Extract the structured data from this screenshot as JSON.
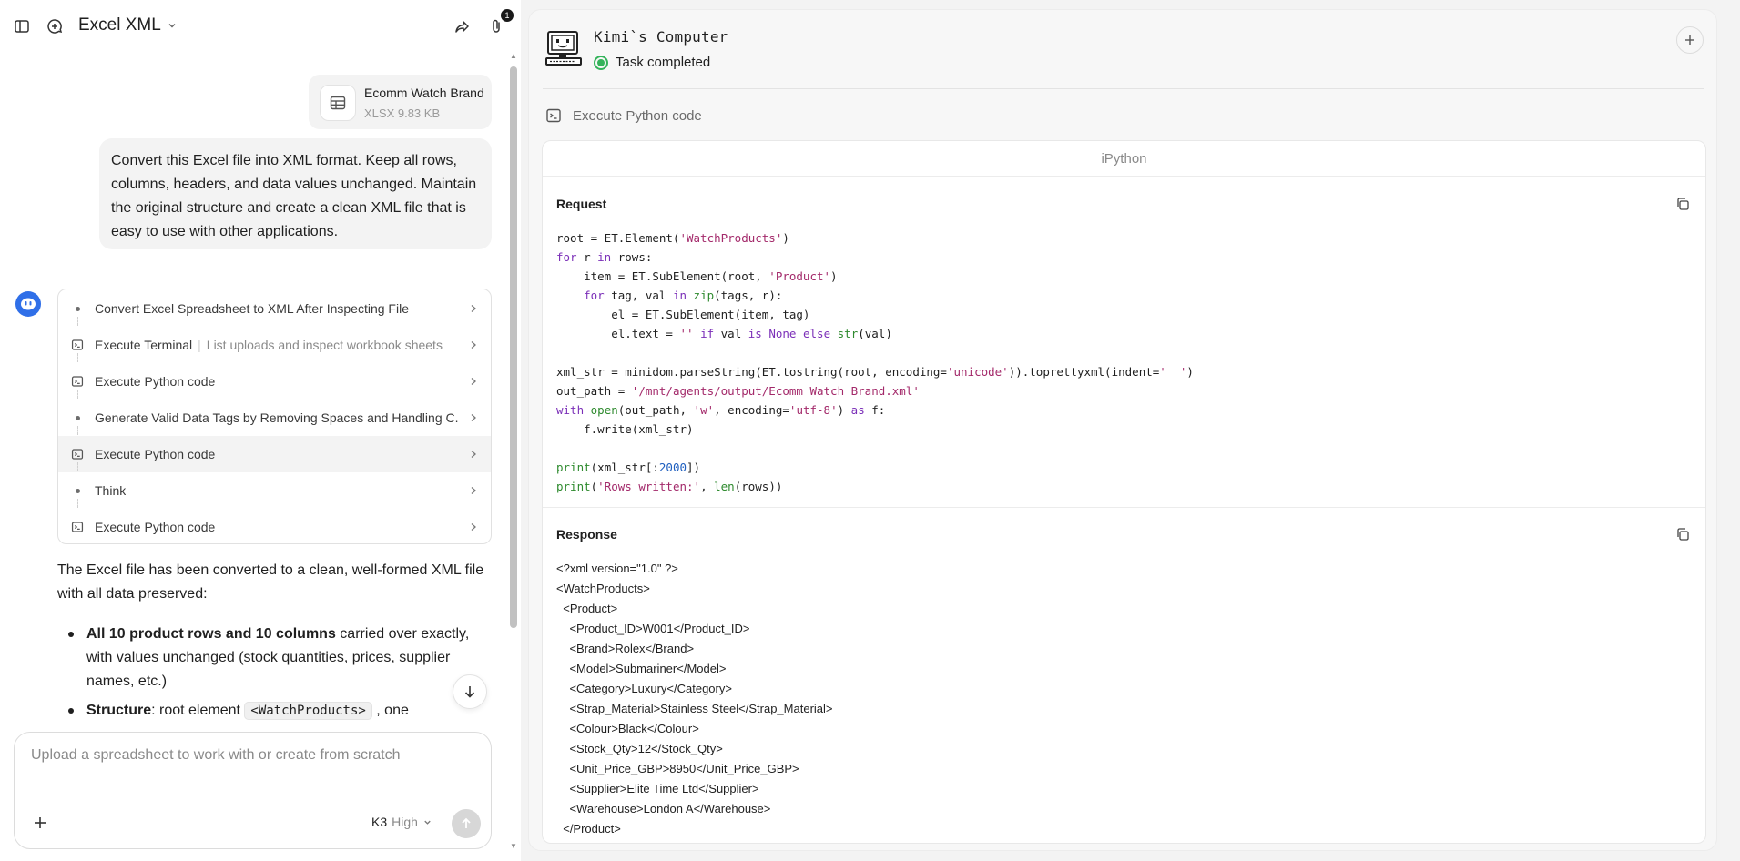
{
  "app": {
    "chat_title": "Excel XML",
    "attachment_count": "1"
  },
  "attachment": {
    "name": "Ecomm Watch Brand",
    "meta": "XLSX 9.83 KB"
  },
  "user_message": "Convert this Excel file into XML format. Keep all rows, columns, headers, and data values unchanged. Maintain the original structure and create a clean XML file that is easy to use with other applications.",
  "steps": [
    {
      "type": "dot",
      "label": "Convert Excel Spreadsheet to XML After Inspecting File",
      "sub": ""
    },
    {
      "type": "terminal",
      "label": "Execute Terminal",
      "sub": "List uploads and inspect workbook sheets"
    },
    {
      "type": "terminal",
      "label": "Execute Python code",
      "sub": ""
    },
    {
      "type": "dot",
      "label": "Generate Valid Data Tags by Removing Spaces and Handling C...",
      "sub": ""
    },
    {
      "type": "terminal",
      "label": "Execute Python code",
      "sub": ""
    },
    {
      "type": "dot",
      "label": "Think",
      "sub": ""
    },
    {
      "type": "terminal",
      "label": "Execute Python code",
      "sub": ""
    }
  ],
  "assistant": {
    "intro": "The Excel file has been converted to a clean, well-formed XML file with all data preserved:",
    "b1_strong": "All 10 product rows and 10 columns",
    "b1_rest": " carried over exactly, with values unchanged (stock quantities, prices, supplier names, etc.)",
    "b2_strong": "Structure",
    "b2_rest": ": root element ",
    "b2_code": "<WatchProducts>",
    "b2_tail": " , one"
  },
  "composer": {
    "placeholder": "Upload a spreadsheet to work with or create from scratch",
    "model": "K3",
    "effort": "High"
  },
  "computer": {
    "title": "Kimi`s Computer",
    "status": "Task completed",
    "current_action": "Execute Python code",
    "tool_name": "iPython",
    "request_label": "Request",
    "response_label": "Response"
  },
  "response_lines": [
    "<?xml version=\"1.0\" ?>",
    "<WatchProducts>",
    "  <Product>",
    "    <Product_ID>W001</Product_ID>",
    "    <Brand>Rolex</Brand>",
    "    <Model>Submariner</Model>",
    "    <Category>Luxury</Category>",
    "    <Strap_Material>Stainless Steel</Strap_Material>",
    "    <Colour>Black</Colour>",
    "    <Stock_Qty>12</Stock_Qty>",
    "    <Unit_Price_GBP>8950</Unit_Price_GBP>",
    "    <Supplier>Elite Time Ltd</Supplier>",
    "    <Warehouse>London A</Warehouse>",
    "  </Product>"
  ],
  "icons": {
    "sidebar": "sidebar-toggle-icon",
    "new_chat": "new-chat-icon",
    "share": "share-icon",
    "attachments": "paperclip-icon",
    "copy": "copy-icon",
    "terminal": "terminal-icon"
  },
  "colors": {
    "status_green": "#34b35a",
    "avatar_blue": "#2f6fe8",
    "keyword": "#7b2fb8",
    "string": "#a3296a",
    "builtin": "#2e8a2e"
  }
}
